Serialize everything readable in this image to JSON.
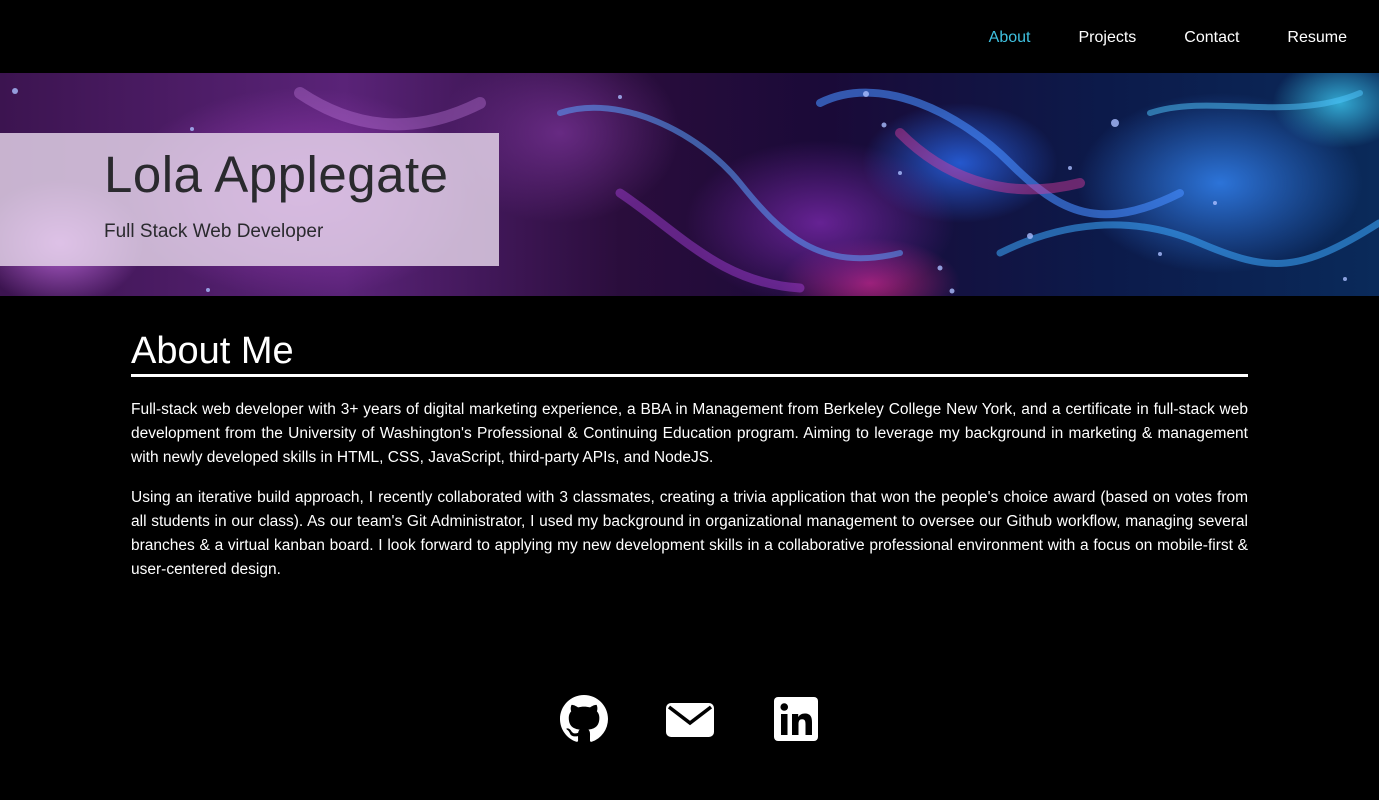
{
  "nav": {
    "items": [
      {
        "label": "About",
        "active": true
      },
      {
        "label": "Projects",
        "active": false
      },
      {
        "label": "Contact",
        "active": false
      },
      {
        "label": "Resume",
        "active": false
      }
    ],
    "active_color": "#3fc1e0"
  },
  "hero": {
    "name": "Lola Applegate",
    "role": "Full Stack Web Developer"
  },
  "about": {
    "heading": "About Me",
    "paragraphs": [
      "Full-stack web developer with 3+ years of digital marketing experience, a BBA in Management from Berkeley College New York, and a certificate in full-stack web development from the University of Washington's Professional & Continuing Education program. Aiming to leverage my background in marketing & management with newly developed skills in HTML, CSS, JavaScript, third-party APIs, and NodeJS.",
      "Using an iterative build approach, I recently collaborated with 3 classmates, creating a trivia application that won the people's choice award (based on votes from all students in our class). As our team's Git Administrator, I used my background in organizational management to oversee our Github workflow, managing several branches & a virtual kanban board. I look forward to applying my new development skills in a collaborative professional environment with a focus on mobile-first & user-centered design."
    ]
  },
  "social": {
    "icons": [
      "github-icon",
      "envelope-icon",
      "linkedin-icon"
    ]
  }
}
